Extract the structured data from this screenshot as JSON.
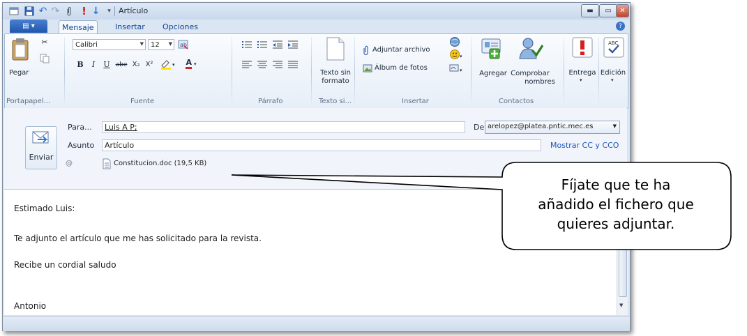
{
  "window": {
    "title": "Artículo"
  },
  "tabs": {
    "file_label": "▤ ▾",
    "items": [
      "Mensaje",
      "Insertar",
      "Opciones"
    ]
  },
  "ribbon": {
    "portapapeles": {
      "pegar": "Pegar",
      "label": "Portapapel..."
    },
    "fuente": {
      "font_name": "Calibri",
      "font_size": "12",
      "bold": "B",
      "italic": "I",
      "underline": "U",
      "strike": "abe",
      "subscript": "X₂",
      "superscript": "X²",
      "font_color": "A",
      "label": "Fuente"
    },
    "parrafo": {
      "label": "Párrafo"
    },
    "texto": {
      "line1": "Texto sin",
      "line2": "formato",
      "label": "Texto si..."
    },
    "insertar": {
      "adjuntar": "Adjuntar archivo",
      "album": "Álbum de fotos",
      "label": "Insertar"
    },
    "contactos": {
      "agregar": "Agregar",
      "comprobar1": "Comprobar",
      "comprobar2": "nombres",
      "label": "Contactos"
    },
    "entrega": {
      "label": "Entrega"
    },
    "edicion": {
      "label": "Edición"
    }
  },
  "compose": {
    "send_label": "Enviar",
    "to_label": "Para...",
    "to_value": "Luis A P;",
    "subject_label": "Asunto",
    "subject_value": "Artículo",
    "from_label": "De",
    "from_value": "arelopez@platea.pntic.mec.es",
    "cc_link": "Mostrar CC y CCO",
    "attachment": "Constitucion.doc (19,5 KB)"
  },
  "body": {
    "lines": [
      "Estimado Luis:",
      "Te adjunto el artículo que me has solicitado para la revista.",
      "Recibe un cordial saludo",
      "Antonio"
    ]
  },
  "callout": {
    "lines": [
      "Fíjate que te ha",
      "añadido el fichero que",
      "quieres adjuntar."
    ]
  },
  "colors": {
    "accent_blue": "#15428b",
    "file_button": "#1f56ad",
    "link_blue": "#1a55b8",
    "high_importance_red": "#d42020"
  }
}
